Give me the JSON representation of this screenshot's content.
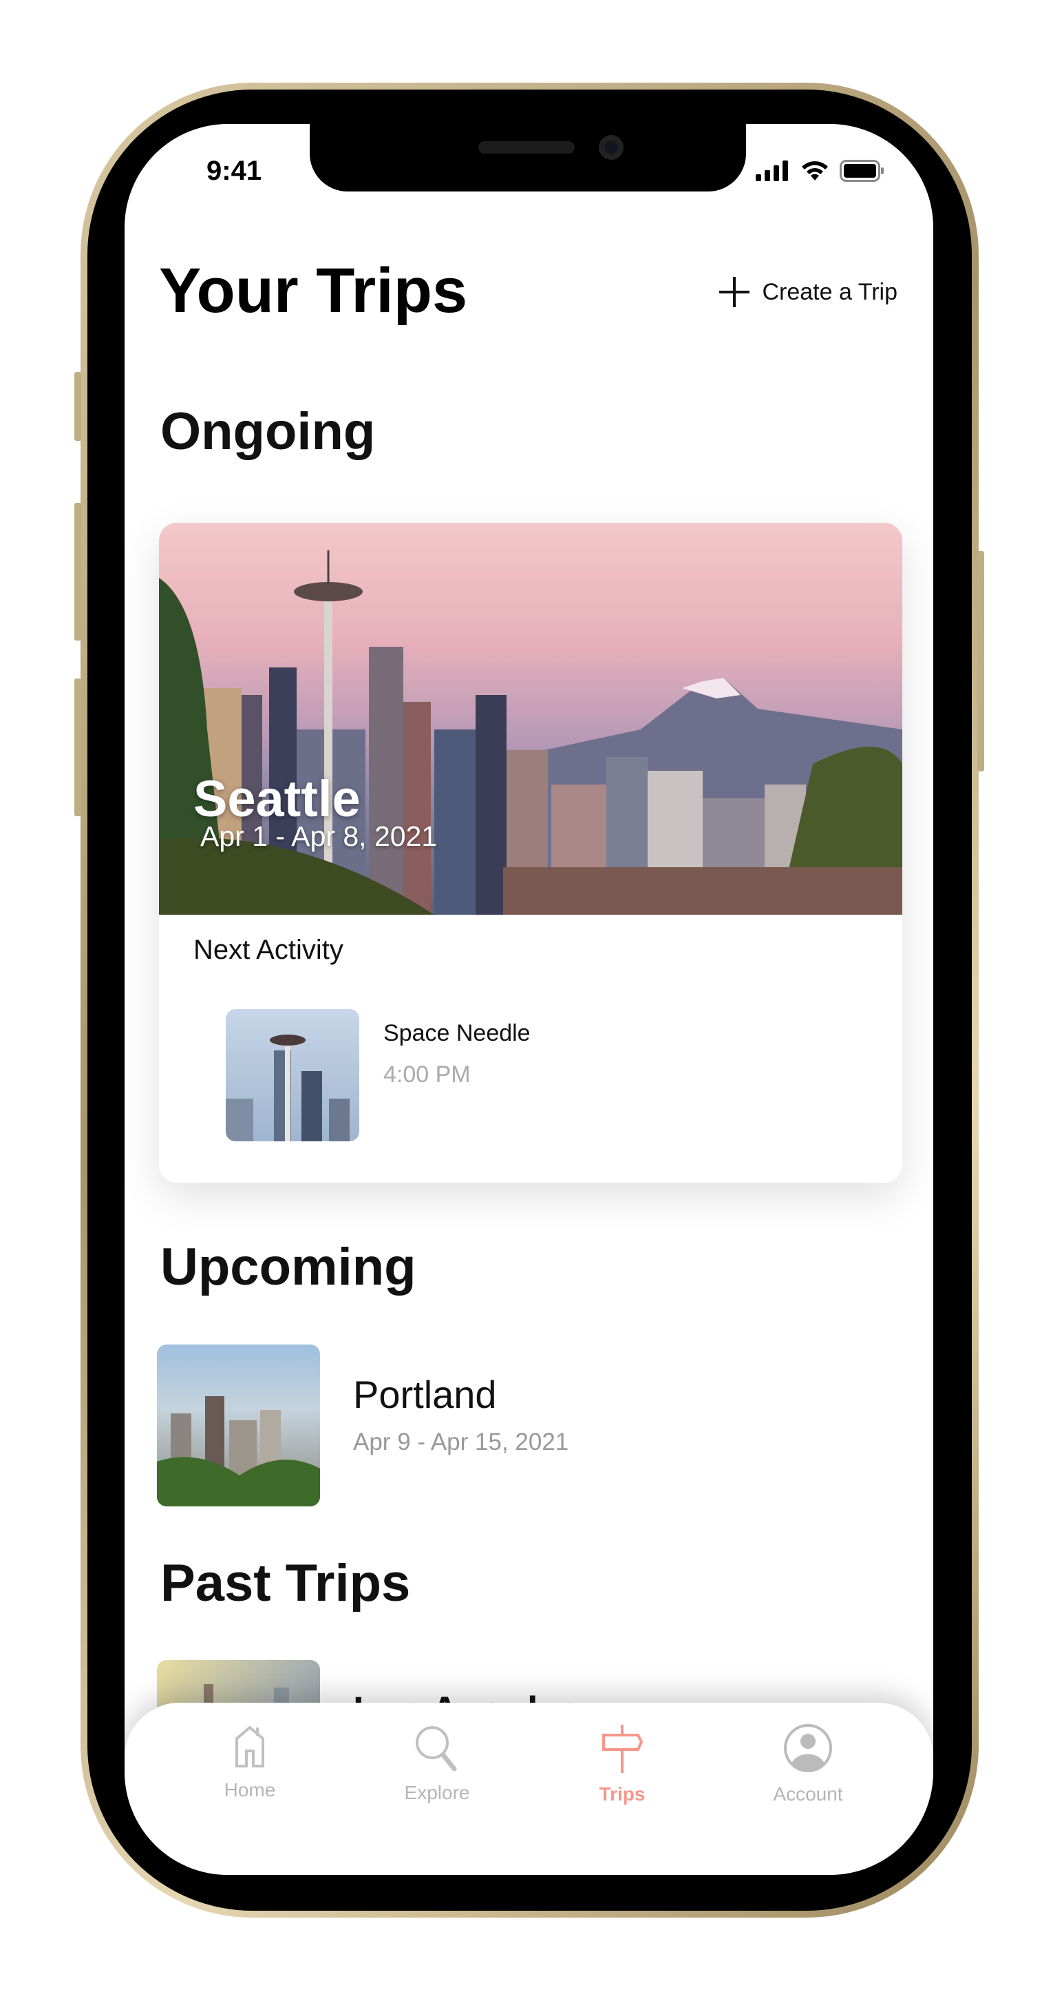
{
  "status_bar": {
    "time": "9:41"
  },
  "header": {
    "title": "Your Trips",
    "create_label": "Create a Trip"
  },
  "ongoing": {
    "section_title": "Ongoing",
    "trip": {
      "city": "Seattle",
      "dates": "Apr 1 - Apr 8, 2021",
      "next_activity_label": "Next Activity",
      "activity": {
        "name": "Space Needle",
        "time": "4:00 PM"
      }
    }
  },
  "upcoming": {
    "section_title": "Upcoming",
    "trips": [
      {
        "city": "Portland",
        "dates": "Apr 9 - Apr 15, 2021"
      }
    ]
  },
  "past": {
    "section_title": "Past Trips",
    "trips": [
      {
        "city": "Los Angeles"
      }
    ]
  },
  "tabbar": {
    "items": [
      {
        "label": "Home",
        "icon": "home-icon"
      },
      {
        "label": "Explore",
        "icon": "search-icon"
      },
      {
        "label": "Trips",
        "icon": "signpost-icon"
      },
      {
        "label": "Account",
        "icon": "account-icon"
      }
    ],
    "active": "Trips"
  },
  "colors": {
    "accent": "#f7968a",
    "inactive": "#b5b5b5"
  }
}
